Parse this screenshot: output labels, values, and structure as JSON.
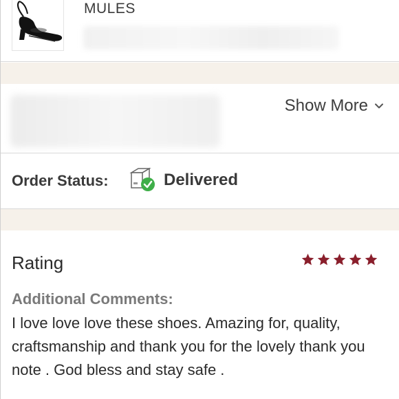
{
  "product": {
    "title": "MULES",
    "image_icon": "black-slingback-mule-shoe"
  },
  "info": {
    "show_more_label": "Show More",
    "show_more_icon": "chevron-down-icon"
  },
  "order_status": {
    "label": "Order Status:",
    "value": "Delivered",
    "icon": "delivered-box-icon",
    "check_color": "#3fae49"
  },
  "rating": {
    "title": "Rating",
    "stars": 5,
    "max_stars": 5,
    "star_color": "#8a1f2c",
    "comments_label": "Additional Comments:",
    "comment_text": "I love love love these shoes. Amazing for, quality, craftsmanship and thank you for the lovely thank you note . God bless and stay safe ."
  },
  "colors": {
    "separator_bg": "#f6f1ea",
    "divider": "#d8d8d8"
  }
}
